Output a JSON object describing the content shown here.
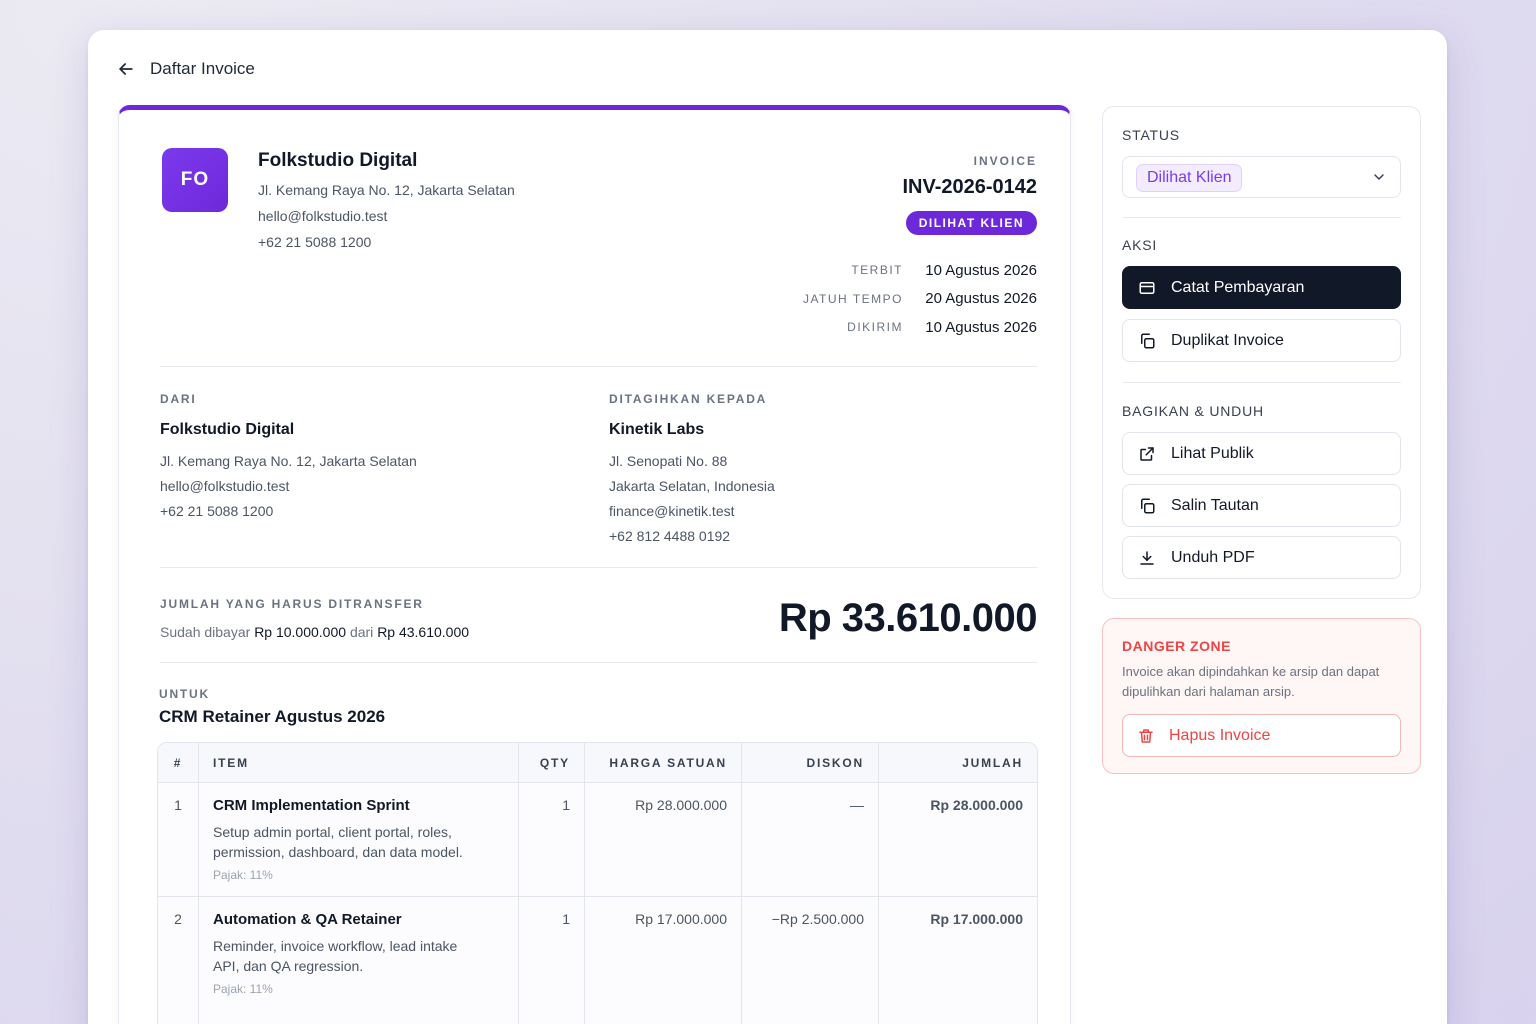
{
  "nav": {
    "back_label": "Daftar Invoice"
  },
  "sender": {
    "initials": "FO",
    "name": "Folkstudio Digital",
    "address": "Jl. Kemang Raya No. 12, Jakarta Selatan",
    "email": "hello@folkstudio.test",
    "phone": "+62 21 5088 1200"
  },
  "invoice": {
    "caption": "INVOICE",
    "number": "INV-2026-0142",
    "status_badge": "DILIHAT KLIEN",
    "dates": [
      {
        "label": "TERBIT",
        "value": "10 Agustus 2026"
      },
      {
        "label": "JATUH TEMPO",
        "value": "20 Agustus 2026"
      },
      {
        "label": "DIKIRIM",
        "value": "10 Agustus 2026"
      }
    ]
  },
  "from": {
    "caption": "DARI",
    "name": "Folkstudio Digital",
    "lines": [
      "Jl. Kemang Raya No. 12, Jakarta Selatan",
      "hello@folkstudio.test",
      "+62 21 5088 1200"
    ]
  },
  "bill_to": {
    "caption": "DITAGIHKAN KEPADA",
    "name": "Kinetik Labs",
    "lines": [
      "Jl. Senopati No. 88",
      "Jakarta Selatan, Indonesia",
      "finance@kinetik.test",
      "+62 812 4488 0192"
    ]
  },
  "amount_due": {
    "caption": "JUMLAH YANG HARUS DITRANSFER",
    "paid_prefix": "Sudah dibayar",
    "paid_value": "Rp 10.000.000",
    "of_word": "dari",
    "total_value": "Rp 43.610.000",
    "amount": "Rp 33.610.000"
  },
  "for": {
    "caption": "UNTUK",
    "title": "CRM Retainer Agustus 2026"
  },
  "table": {
    "headers": {
      "num": "#",
      "item": "ITEM",
      "qty": "QTY",
      "price": "HARGA SATUAN",
      "discount": "DISKON",
      "amount": "JUMLAH"
    },
    "rows": [
      {
        "num": "1",
        "name": "CRM Implementation Sprint",
        "desc": "Setup admin portal, client portal, roles, permission, dashboard, dan data model.",
        "tax": "Pajak: 11%",
        "qty": "1",
        "price": "Rp 28.000.000",
        "discount": "—",
        "amount": "Rp 28.000.000"
      },
      {
        "num": "2",
        "name": "Automation & QA Retainer",
        "desc": "Reminder, invoice workflow, lead intake API, dan QA regression.",
        "tax": "Pajak: 11%",
        "qty": "1",
        "price": "Rp 17.000.000",
        "discount": "−Rp 2.500.000",
        "amount": "Rp 17.000.000"
      }
    ]
  },
  "side": {
    "status_caption": "STATUS",
    "status_value": "Dilihat Klien",
    "actions_caption": "AKSI",
    "record_payment": "Catat Pembayaran",
    "duplicate": "Duplikat Invoice",
    "share_caption": "BAGIKAN & UNDUH",
    "view_public": "Lihat Publik",
    "copy_link": "Salin Tautan",
    "download_pdf": "Unduh PDF"
  },
  "danger": {
    "caption": "DANGER ZONE",
    "text": "Invoice akan dipindahkan ke arsip dan dapat dipulihkan dari halaman arsip.",
    "delete_label": "Hapus Invoice"
  },
  "colors": {
    "accent": "#6d28d9",
    "dark_button": "#111827",
    "danger": "#ef4444",
    "discount_negative": "#dc2626"
  }
}
